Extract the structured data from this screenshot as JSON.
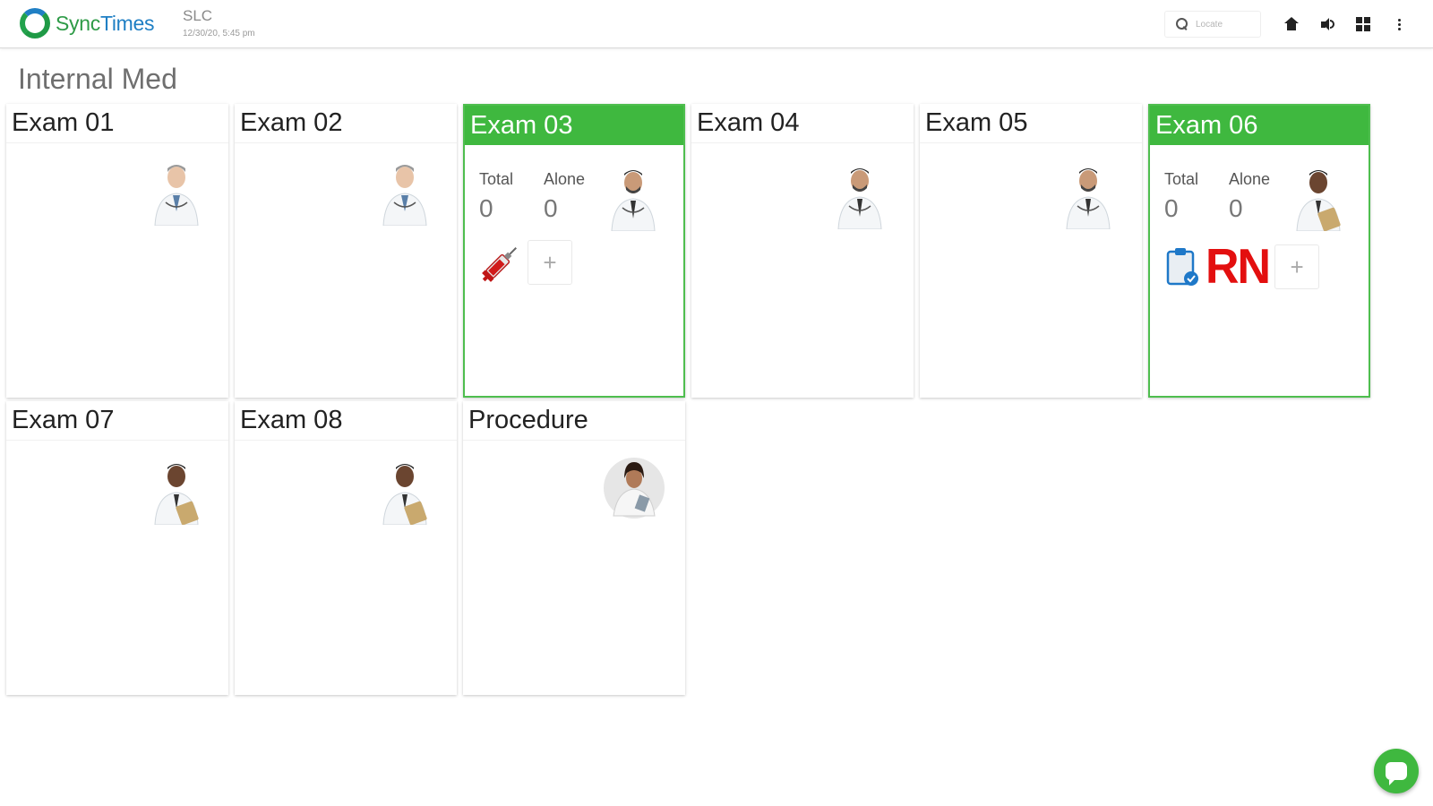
{
  "header": {
    "logo_sync": "Sync",
    "logo_times": "Times",
    "site_name": "SLC",
    "datetime": "12/30/20, 5:45 pm",
    "search_placeholder": "Locate"
  },
  "section_title": "Internal Med",
  "rooms": [
    {
      "name": "Exam 01",
      "active": false,
      "provider": "male-doctor-grey-icon"
    },
    {
      "name": "Exam 02",
      "active": false,
      "provider": "male-doctor-grey-icon"
    },
    {
      "name": "Exam 03",
      "active": true,
      "provider": "male-doctor-beard-icon",
      "total_label": "Total",
      "total_value": "0",
      "alone_label": "Alone",
      "alone_value": "0",
      "tools": [
        "syringe-icon"
      ],
      "add_label": "+"
    },
    {
      "name": "Exam 04",
      "active": false,
      "provider": "male-doctor-beard-icon"
    },
    {
      "name": "Exam 05",
      "active": false,
      "provider": "male-doctor-beard-icon"
    },
    {
      "name": "Exam 06",
      "active": true,
      "provider": "male-doctor-clipboard-icon",
      "total_label": "Total",
      "total_value": "0",
      "alone_label": "Alone",
      "alone_value": "0",
      "tools": [
        "clipboard-check-icon"
      ],
      "rn_label": "RN",
      "add_label": "+"
    },
    {
      "name": "Exam 07",
      "active": false,
      "provider": "male-doctor-clipboard-icon"
    },
    {
      "name": "Exam 08",
      "active": false,
      "provider": "male-doctor-clipboard-icon"
    },
    {
      "name": "Procedure",
      "active": false,
      "provider": "female-doctor-icon"
    }
  ],
  "colors": {
    "active_green": "#3fb83f",
    "rn_red": "#e30f0f",
    "logo_green": "#2e9b47",
    "logo_blue": "#1f7fc4"
  }
}
